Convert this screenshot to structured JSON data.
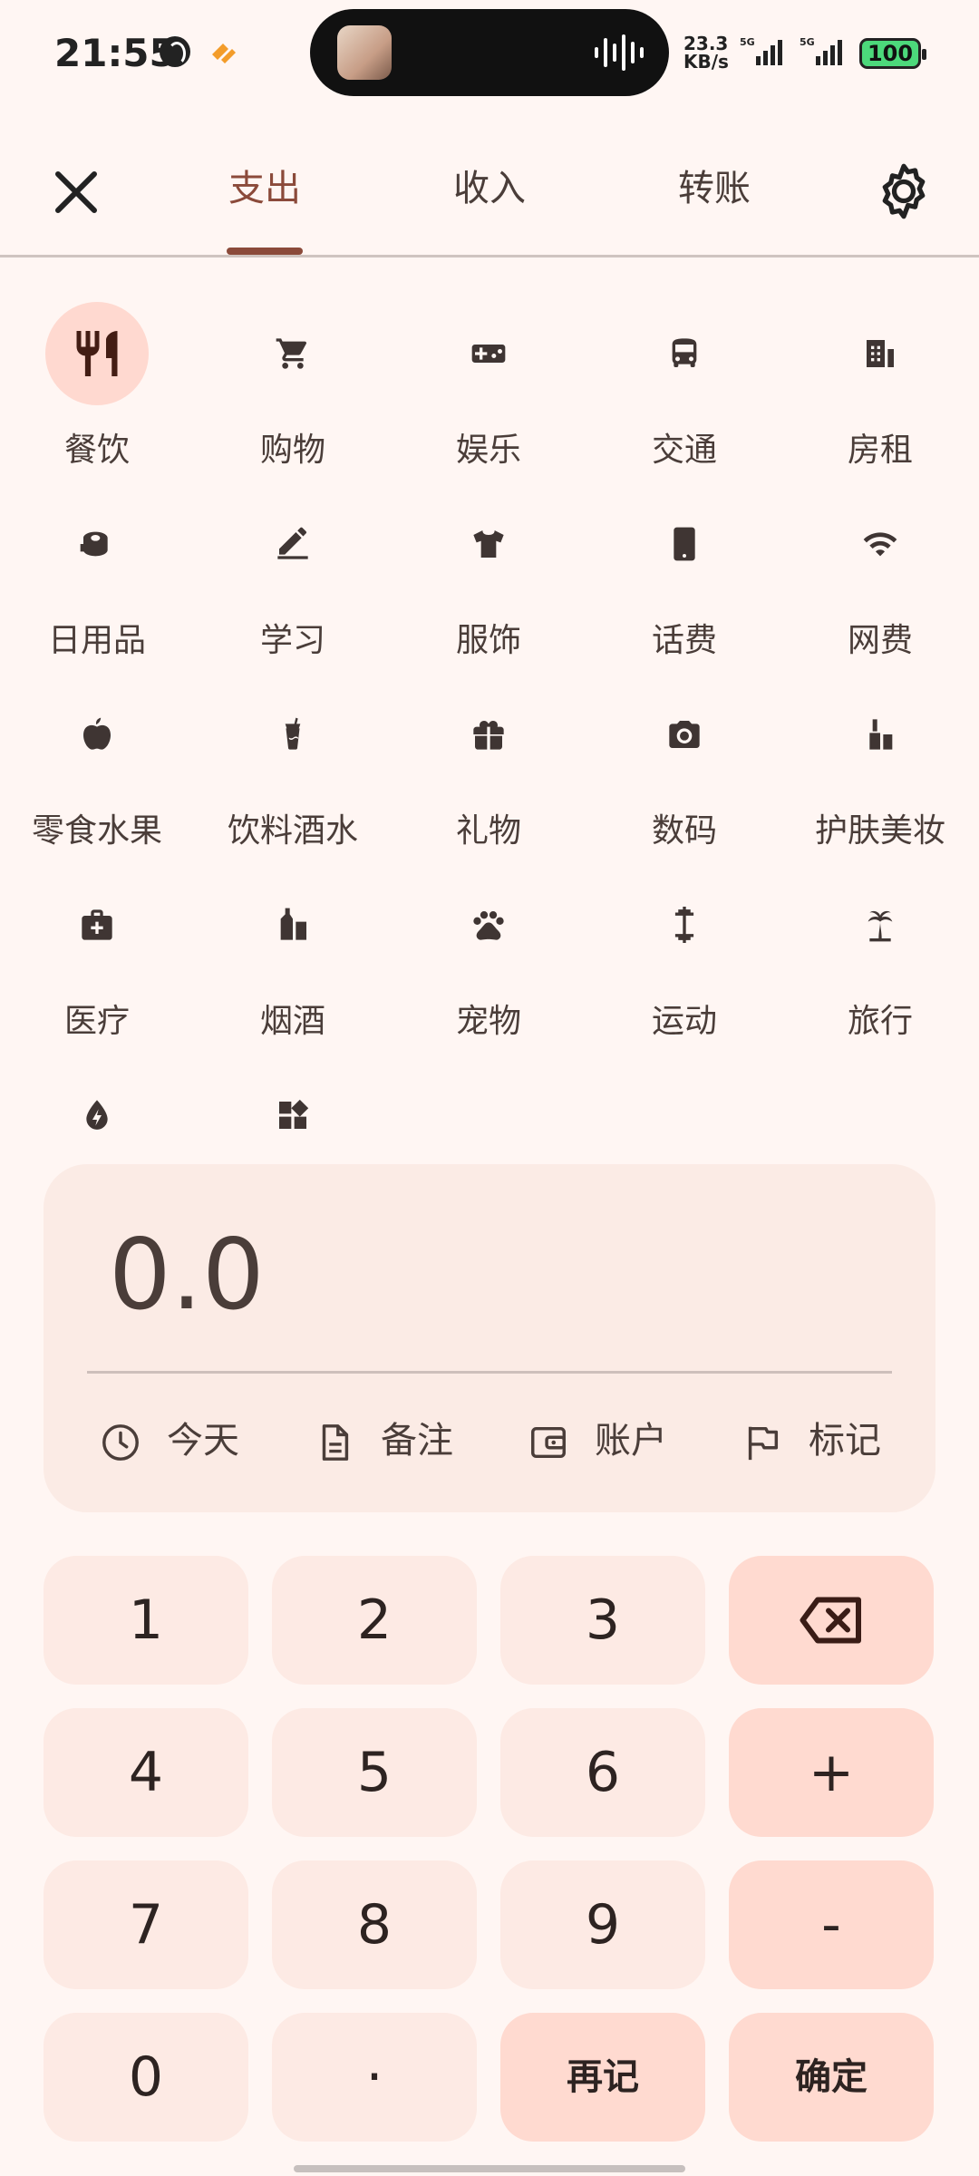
{
  "status_bar": {
    "time": "21:55",
    "speed": "23.3",
    "speed_unit": "KB/s",
    "net1": "5G",
    "net2": "5G",
    "battery": "100"
  },
  "header": {
    "tabs": [
      {
        "label": "支出",
        "active": true
      },
      {
        "label": "收入",
        "active": false
      },
      {
        "label": "转账",
        "active": false
      }
    ]
  },
  "categories": [
    {
      "label": "餐饮",
      "icon": "restaurant-icon",
      "selected": true
    },
    {
      "label": "购物",
      "icon": "cart-icon"
    },
    {
      "label": "娱乐",
      "icon": "gamepad-icon"
    },
    {
      "label": "交通",
      "icon": "bus-icon"
    },
    {
      "label": "房租",
      "icon": "building-icon"
    },
    {
      "label": "日用品",
      "icon": "tissue-roll-icon"
    },
    {
      "label": "学习",
      "icon": "edit-icon"
    },
    {
      "label": "服饰",
      "icon": "shirt-icon"
    },
    {
      "label": "话费",
      "icon": "phone-icon"
    },
    {
      "label": "网费",
      "icon": "wifi-icon"
    },
    {
      "label": "零食水果",
      "icon": "apple-icon"
    },
    {
      "label": "饮料酒水",
      "icon": "drink-cup-icon"
    },
    {
      "label": "礼物",
      "icon": "gift-icon"
    },
    {
      "label": "数码",
      "icon": "camera-icon"
    },
    {
      "label": "护肤美妆",
      "icon": "lipstick-icon"
    },
    {
      "label": "医疗",
      "icon": "medical-kit-icon"
    },
    {
      "label": "烟酒",
      "icon": "liquor-icon"
    },
    {
      "label": "宠物",
      "icon": "paw-icon"
    },
    {
      "label": "运动",
      "icon": "dumbbell-icon"
    },
    {
      "label": "旅行",
      "icon": "palm-tree-icon"
    },
    {
      "label": "",
      "icon": "energy-drop-icon"
    },
    {
      "label": "",
      "icon": "widgets-icon"
    }
  ],
  "amount": {
    "value": "0.0"
  },
  "actions": [
    {
      "label": "今天",
      "icon": "clock-icon"
    },
    {
      "label": "备注",
      "icon": "note-icon"
    },
    {
      "label": "账户",
      "icon": "wallet-icon"
    },
    {
      "label": "标记",
      "icon": "flag-icon"
    }
  ],
  "keypad": {
    "rows": [
      [
        "1",
        "2",
        "3",
        "⌫"
      ],
      [
        "4",
        "5",
        "6",
        "+"
      ],
      [
        "7",
        "8",
        "9",
        "-"
      ],
      [
        "0",
        "·",
        "再记",
        "确定"
      ]
    ]
  }
}
